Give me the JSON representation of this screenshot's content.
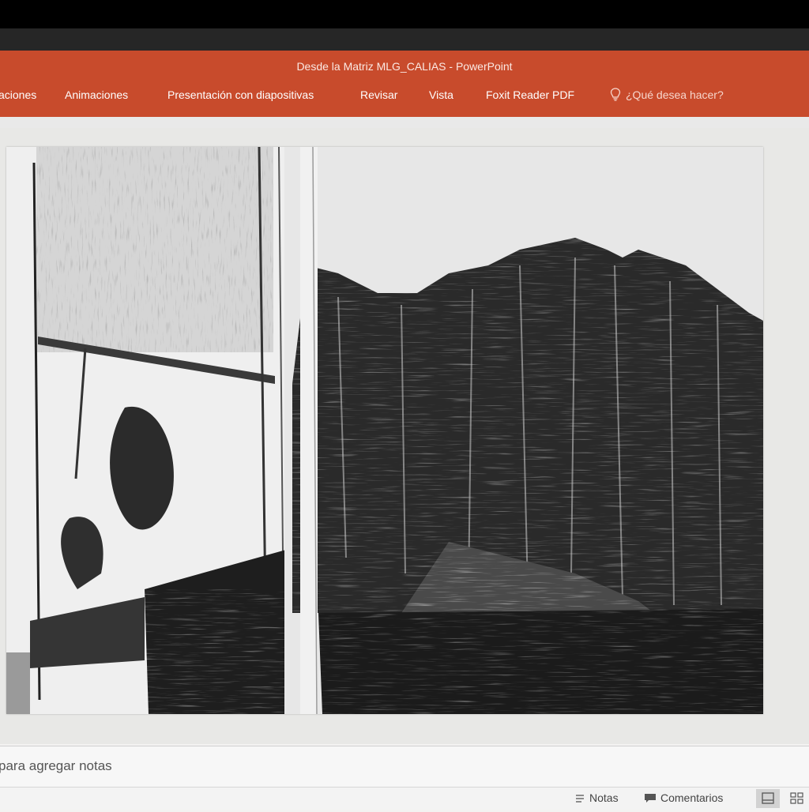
{
  "window": {
    "title": "Desde la Matriz MLG_CALIAS - PowerPoint"
  },
  "ribbon": {
    "tabs": [
      {
        "label": "aciones"
      },
      {
        "label": "Animaciones"
      },
      {
        "label": "Presentación con diapositivas"
      },
      {
        "label": "Revisar"
      },
      {
        "label": "Vista"
      },
      {
        "label": "Foxit Reader PDF"
      }
    ],
    "tell_me": "¿Qué desea hacer?",
    "tell_me_icon": "lightbulb-icon"
  },
  "slide": {
    "image_description_icon": "etching-artwork"
  },
  "notes": {
    "placeholder": "para agregar notas"
  },
  "statusbar": {
    "notes_label": "Notas",
    "comments_label": "Comentarios",
    "notes_icon": "notes-icon",
    "comments_icon": "comment-icon"
  },
  "colors": {
    "ribbon": "#c84b2c",
    "titlebar": "#000000"
  }
}
